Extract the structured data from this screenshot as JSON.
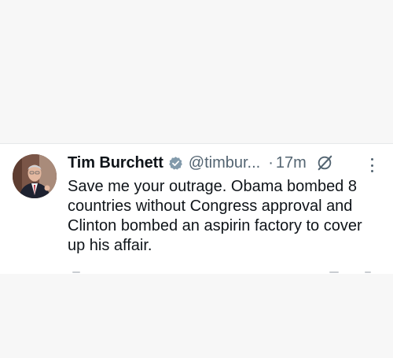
{
  "tweet": {
    "author_name": "Tim Burchett",
    "handle": "@timbur...",
    "separator": "·",
    "time": "17m",
    "text": "Save me your outrage. Obama bombed 8 countries without Congress approval and Clinton bombed an aspirin factory to cover up his affair."
  },
  "icons": {
    "verified": "verified-badge-icon",
    "grok": "grok-icon",
    "more": "more-options-icon"
  },
  "colors": {
    "text_primary": "#0f1419",
    "text_secondary": "#536471",
    "background": "#ffffff",
    "page_background": "#f7f7f7"
  }
}
